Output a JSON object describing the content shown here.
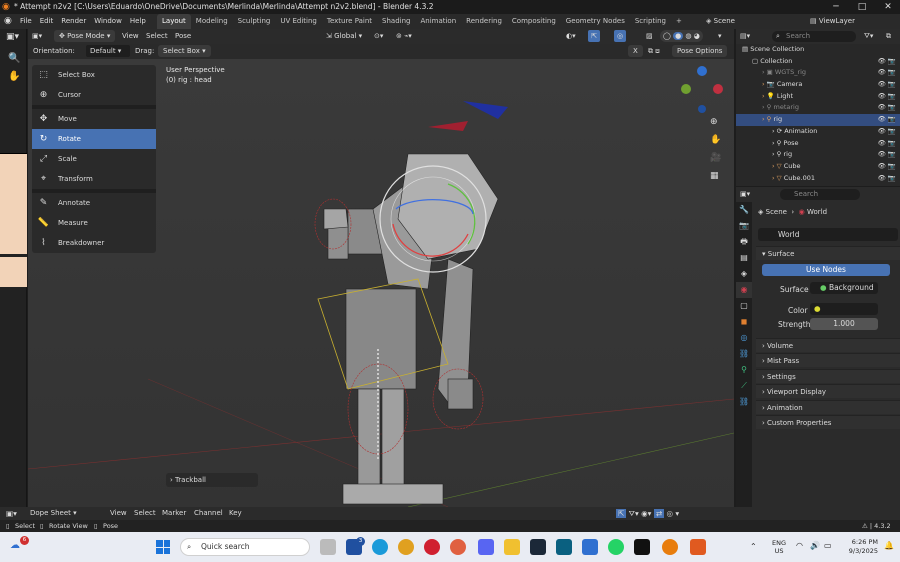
{
  "window": {
    "title": "* Attempt n2v2 [C:\\Users\\Eduardo\\OneDrive\\Documents\\Merlinda\\Merlinda\\Attempt n2v2.blend] - Blender 4.3.2"
  },
  "menu": {
    "items": [
      "File",
      "Edit",
      "Render",
      "Window",
      "Help"
    ]
  },
  "workspaces": {
    "tabs": [
      "Layout",
      "Modeling",
      "Sculpting",
      "UV Editing",
      "Texture Paint",
      "Shading",
      "Animation",
      "Rendering",
      "Compositing",
      "Geometry Nodes",
      "Scripting"
    ],
    "active": "Layout",
    "plus": "+"
  },
  "top_right": {
    "scene": "Scene",
    "view_layer": "ViewLayer"
  },
  "viewport_header": {
    "mode": "Pose Mode",
    "view": "View",
    "select": "Select",
    "pose": "Pose",
    "transform_orientation": "Global",
    "orientation_label": "Orientation:",
    "orientation_value": "Default",
    "drag_label": "Drag:",
    "drag_value": "Select Box",
    "pose_options": "Pose Options",
    "x_label": "X"
  },
  "viewport": {
    "info_line1": "User Perspective",
    "info_line2": "(0) rig : head",
    "last_op": "Trackball"
  },
  "tools": [
    {
      "label": "Select Box",
      "icon": "⬚"
    },
    {
      "label": "Cursor",
      "icon": "⊕"
    },
    {
      "label": "Move",
      "icon": "✥"
    },
    {
      "label": "Rotate",
      "icon": "↻"
    },
    {
      "label": "Scale",
      "icon": "⤢"
    },
    {
      "label": "Transform",
      "icon": "⌖"
    },
    {
      "label": "Annotate",
      "icon": "✎"
    },
    {
      "label": "Measure",
      "icon": "📏"
    },
    {
      "label": "Breakdowner",
      "icon": "⌇"
    }
  ],
  "outliner": {
    "search_placeholder": "Search",
    "rows": [
      {
        "label": "Scene Collection",
        "indent": 0
      },
      {
        "label": "Collection",
        "indent": 1
      },
      {
        "label": "WGTS_rig",
        "indent": 2
      },
      {
        "label": "Camera",
        "indent": 2
      },
      {
        "label": "Light",
        "indent": 2
      },
      {
        "label": "metarig",
        "indent": 2
      },
      {
        "label": "rig",
        "indent": 2
      },
      {
        "label": "Animation",
        "indent": 3
      },
      {
        "label": "Pose",
        "indent": 3
      },
      {
        "label": "rig",
        "indent": 3
      },
      {
        "label": "Cube",
        "indent": 3
      },
      {
        "label": "Cube.001",
        "indent": 3
      }
    ]
  },
  "properties": {
    "search_placeholder": "Search",
    "breadcrumb_scene": "Scene",
    "breadcrumb_world": "World",
    "world_name": "World",
    "surface_header": "Surface",
    "use_nodes": "Use Nodes",
    "surface_label": "Surface",
    "surface_value": "Background",
    "color_label": "Color",
    "strength_label": "Strength",
    "strength_value": "1.000",
    "sections": [
      "Volume",
      "Mist Pass",
      "Settings",
      "Viewport Display",
      "Animation",
      "Custom Properties"
    ]
  },
  "dopesheet": {
    "mode": "Dope Sheet",
    "view": "View",
    "select": "Select",
    "marker": "Marker",
    "channel": "Channel",
    "key": "Key"
  },
  "statusbar": {
    "select": "Select",
    "rotate_view": "Rotate View",
    "pose": "Pose",
    "version": "4.3.2"
  },
  "taskbar": {
    "search": "Quick search",
    "badge_notif": "6",
    "badge_app": "3",
    "lang1": "ENG",
    "lang2": "US",
    "time": "6:26 PM",
    "date": "9/3/2025"
  },
  "colors": {
    "accent": "#4772b3",
    "selected_row": "#334d80",
    "viewport_bg": "#393939"
  }
}
